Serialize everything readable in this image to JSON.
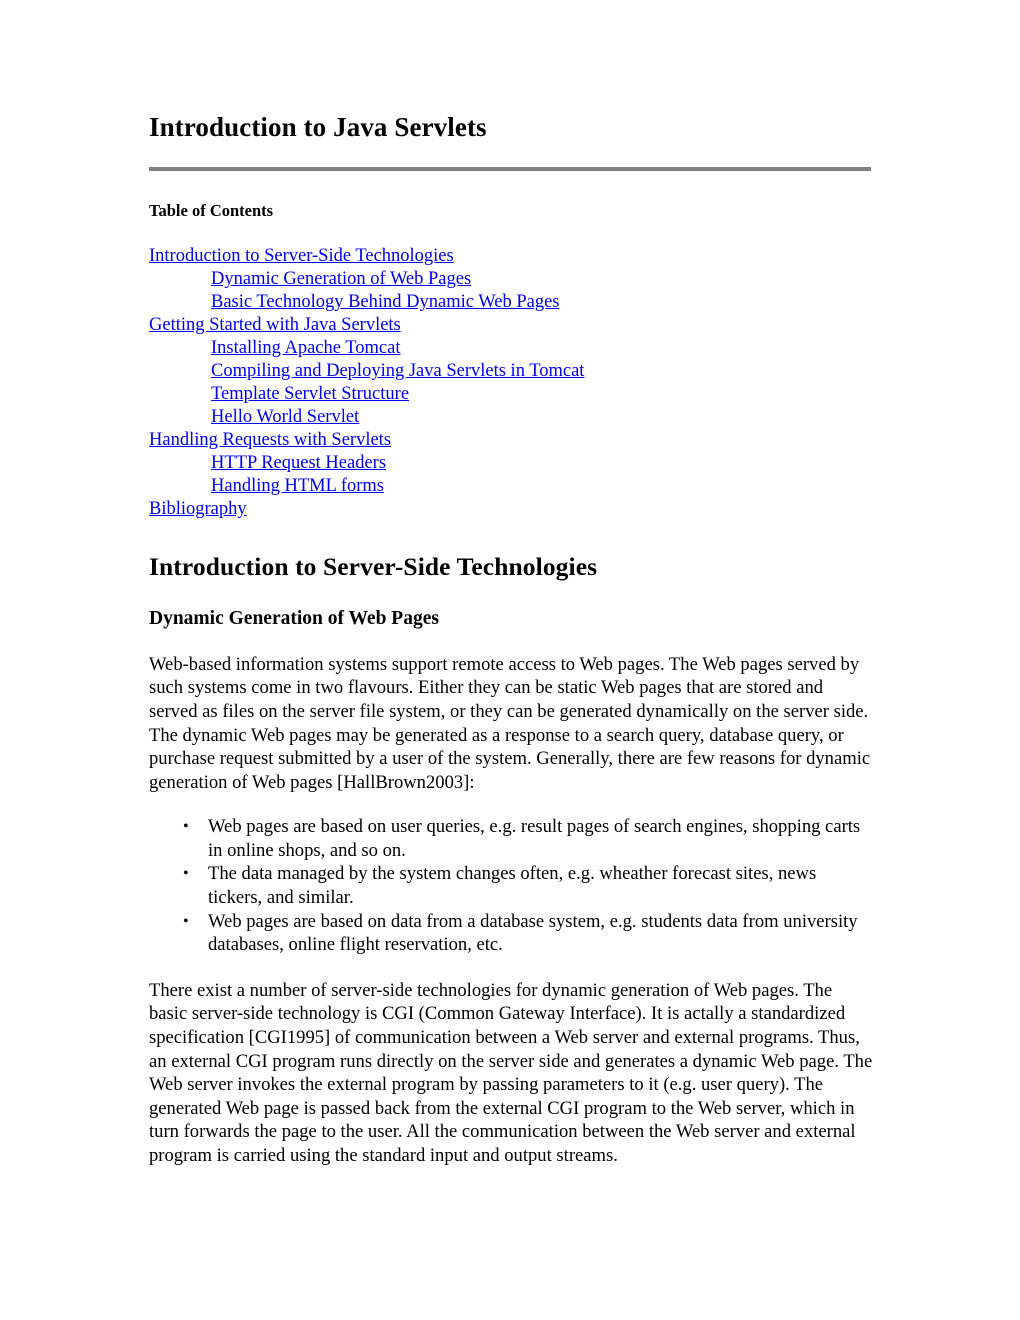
{
  "document": {
    "title": "Introduction to Java Servlets",
    "toc_heading": "Table of Contents",
    "toc": [
      {
        "label": "Introduction to Server-Side Technologies",
        "level": 1
      },
      {
        "label": "Dynamic Generation of Web Pages",
        "level": 2
      },
      {
        "label": "Basic Technology Behind Dynamic Web Pages",
        "level": 2
      },
      {
        "label": "Getting Started with Java Servlets",
        "level": 1
      },
      {
        "label": "Installing Apache Tomcat",
        "level": 2
      },
      {
        "label": "Compiling and Deploying Java Servlets in Tomcat",
        "level": 2
      },
      {
        "label": "Template Servlet Structure",
        "level": 2
      },
      {
        "label": "Hello World Servlet",
        "level": 2
      },
      {
        "label": "Handling Requests with Servlets",
        "level": 1
      },
      {
        "label": "HTTP Request Headers",
        "level": 2
      },
      {
        "label": "Handling HTML forms",
        "level": 2
      },
      {
        "label": "Bibliography",
        "level": 1
      }
    ],
    "section": {
      "heading": "Introduction to Server-Side Technologies",
      "subheading": "Dynamic Generation of Web Pages",
      "paragraph_1": "Web-based information systems support remote access to Web pages. The Web pages served by such systems come in two flavours. Either they can be static Web pages that are stored and served as files on the server file system, or they can be generated dynamically on the server side. The dynamic Web pages may be generated as a response to a search query, database query, or purchase request submitted by a user of the system. Generally, there are few reasons for dynamic generation of Web pages [HallBrown2003]:",
      "bullets": [
        "Web pages are based on user queries, e.g. result pages of search engines, shopping carts in online shops, and so on.",
        "The data managed by the system changes often, e.g. wheather forecast sites, news tickers, and similar.",
        "Web pages are based on data from a database system, e.g. students data from university databases, online flight reservation, etc."
      ],
      "bullet_glyph": "•",
      "paragraph_2": "There exist a number of server-side technologies for dynamic generation of Web pages. The basic server-side technology is CGI (Common Gateway Interface). It is actally a standardized specification [CGI1995] of communication between a Web server and external programs. Thus, an external CGI program runs directly on the server side and generates a dynamic Web page. The Web server invokes the external program by passing parameters to it (e.g. user query). The generated Web page is passed back from the external CGI program to the Web server, which in turn forwards the page to the user. All the communication between the Web server and external program is carried using the standard input and output streams."
    },
    "colors": {
      "link": "#0000ee",
      "rule": "#808080",
      "text": "#000000",
      "background": "#ffffff"
    }
  }
}
